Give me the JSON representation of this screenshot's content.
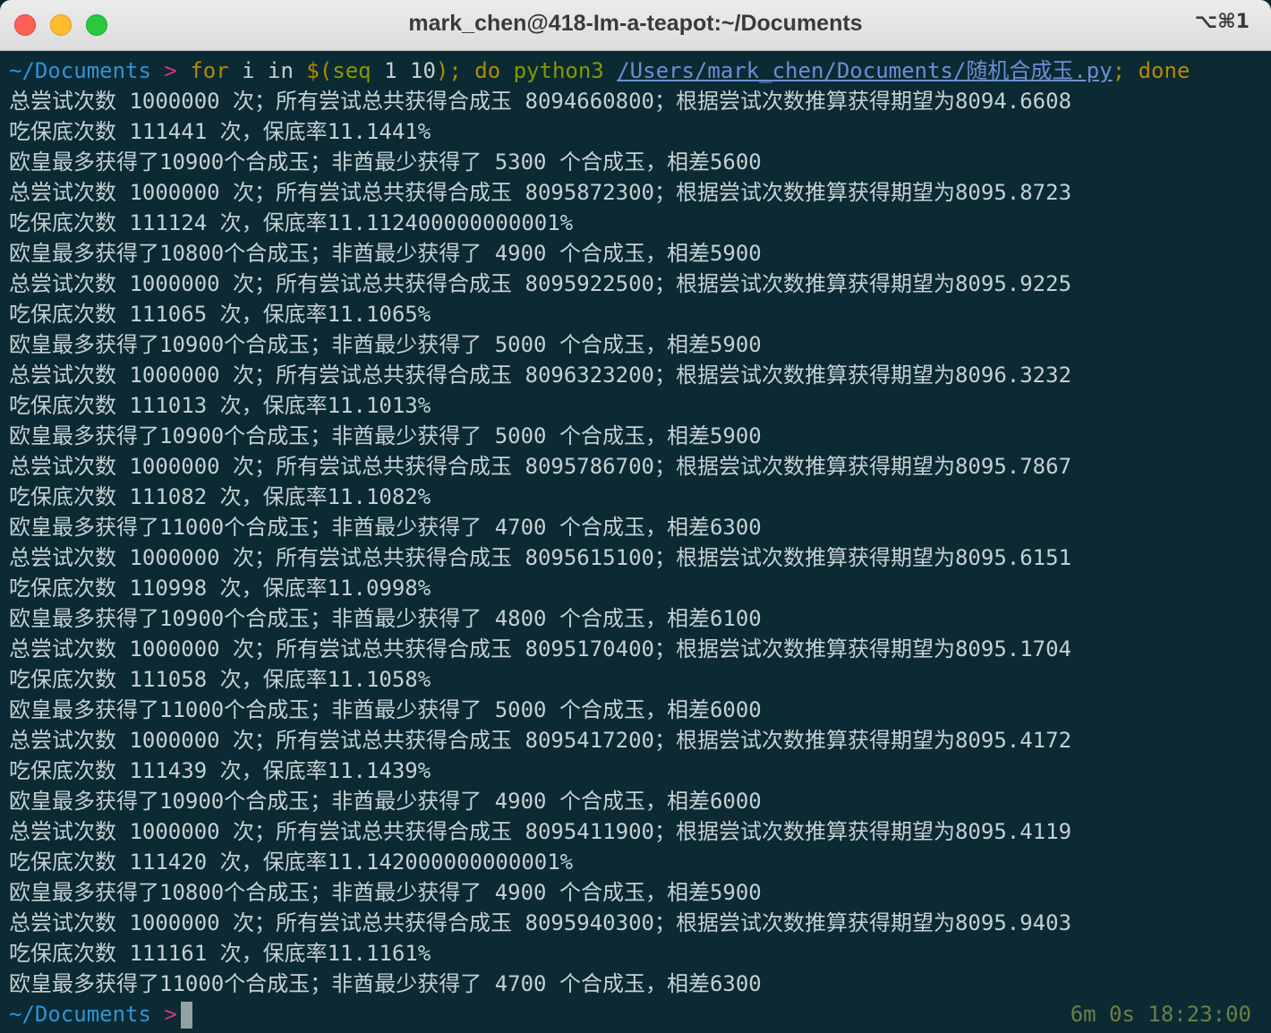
{
  "window": {
    "title": "mark_chen@418-Im-a-teapot:~/Documents",
    "shortcut": "⌥⌘1"
  },
  "colors": {
    "background": "#0b2a33",
    "path": "#2f93d8",
    "prompt_arrow": "#d33682",
    "keyword": "#b58900",
    "command": "#859900",
    "text": "#c5d0d3"
  },
  "command": {
    "path": "~/Documents",
    "arrow": ">",
    "kw_for": "for",
    "loop": " i in ",
    "subst_open": "$(",
    "seq_cmd": "seq",
    "seq_args": " 1 10",
    "subst_close": ");",
    "kw_do": "do",
    "python": "python3",
    "file": "/Users/mark_chen/Documents/随机合成玉.py",
    "semicolon": ";",
    "kw_done": "done"
  },
  "output_lines": [
    "总尝试次数 1000000 次；所有尝试总共获得合成玉 8094660800；根据尝试次数推算获得期望为8094.6608",
    "吃保底次数 111441 次，保底率11.1441%",
    "欧皇最多获得了10900个合成玉；非酋最少获得了 5300 个合成玉，相差5600",
    "总尝试次数 1000000 次；所有尝试总共获得合成玉 8095872300；根据尝试次数推算获得期望为8095.8723",
    "吃保底次数 111124 次，保底率11.112400000000001%",
    "欧皇最多获得了10800个合成玉；非酋最少获得了 4900 个合成玉，相差5900",
    "总尝试次数 1000000 次；所有尝试总共获得合成玉 8095922500；根据尝试次数推算获得期望为8095.9225",
    "吃保底次数 111065 次，保底率11.1065%",
    "欧皇最多获得了10900个合成玉；非酋最少获得了 5000 个合成玉，相差5900",
    "总尝试次数 1000000 次；所有尝试总共获得合成玉 8096323200；根据尝试次数推算获得期望为8096.3232",
    "吃保底次数 111013 次，保底率11.1013%",
    "欧皇最多获得了10900个合成玉；非酋最少获得了 5000 个合成玉，相差5900",
    "总尝试次数 1000000 次；所有尝试总共获得合成玉 8095786700；根据尝试次数推算获得期望为8095.7867",
    "吃保底次数 111082 次，保底率11.1082%",
    "欧皇最多获得了11000个合成玉；非酋最少获得了 4700 个合成玉，相差6300",
    "总尝试次数 1000000 次；所有尝试总共获得合成玉 8095615100；根据尝试次数推算获得期望为8095.6151",
    "吃保底次数 110998 次，保底率11.0998%",
    "欧皇最多获得了10900个合成玉；非酋最少获得了 4800 个合成玉，相差6100",
    "总尝试次数 1000000 次；所有尝试总共获得合成玉 8095170400；根据尝试次数推算获得期望为8095.1704",
    "吃保底次数 111058 次，保底率11.1058%",
    "欧皇最多获得了11000个合成玉；非酋最少获得了 5000 个合成玉，相差6000",
    "总尝试次数 1000000 次；所有尝试总共获得合成玉 8095417200；根据尝试次数推算获得期望为8095.4172",
    "吃保底次数 111439 次，保底率11.1439%",
    "欧皇最多获得了10900个合成玉；非酋最少获得了 4900 个合成玉，相差6000",
    "总尝试次数 1000000 次；所有尝试总共获得合成玉 8095411900；根据尝试次数推算获得期望为8095.4119",
    "吃保底次数 111420 次，保底率11.142000000000001%",
    "欧皇最多获得了10800个合成玉；非酋最少获得了 4900 个合成玉，相差5900",
    "总尝试次数 1000000 次；所有尝试总共获得合成玉 8095940300；根据尝试次数推算获得期望为8095.9403",
    "吃保底次数 111161 次，保底率11.1161%",
    "欧皇最多获得了11000个合成玉；非酋最少获得了 4700 个合成玉，相差6300"
  ],
  "prompt": {
    "path": "~/Documents",
    "arrow": ">",
    "right_status": "6m 0s 18:23:00"
  }
}
